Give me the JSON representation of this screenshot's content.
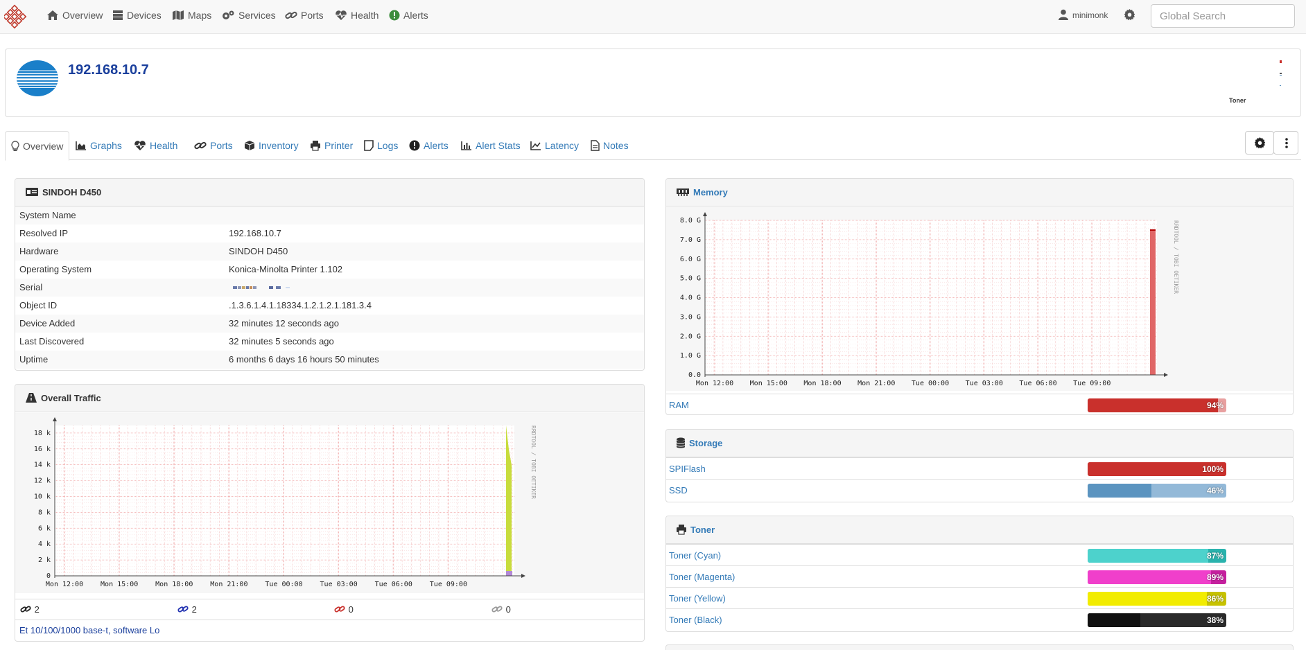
{
  "nav": {
    "items": [
      {
        "label": "Overview",
        "icon": "home-icon"
      },
      {
        "label": "Devices",
        "icon": "server-icon"
      },
      {
        "label": "Maps",
        "icon": "map-icon"
      },
      {
        "label": "Services",
        "icon": "cogs-icon"
      },
      {
        "label": "Ports",
        "icon": "link-icon"
      },
      {
        "label": "Health",
        "icon": "heartbeat-icon"
      },
      {
        "label": "Alerts",
        "icon": "alert-circle-icon"
      }
    ],
    "user": "minimonk",
    "search_placeholder": "Global Search"
  },
  "device": {
    "title": "192.168.10.7",
    "toner_mini_label": "Toner"
  },
  "tabs": [
    "Overview",
    "Graphs",
    "Health",
    "Ports",
    "Inventory",
    "Printer",
    "Logs",
    "Alerts",
    "Alert Stats",
    "Latency",
    "Notes"
  ],
  "overview_panel": {
    "title": "SINDOH D450",
    "rows": [
      {
        "key": "System Name",
        "value": ""
      },
      {
        "key": "Resolved IP",
        "value": "192.168.10.7"
      },
      {
        "key": "Hardware",
        "value": "SINDOH D450"
      },
      {
        "key": "Operating System",
        "value": "Konica-Minolta Printer 1.102"
      },
      {
        "key": "Serial",
        "value": ""
      },
      {
        "key": "Object ID",
        "value": ".1.3.6.1.4.1.18334.1.2.1.2.1.181.3.4"
      },
      {
        "key": "Device Added",
        "value": "32 minutes 12 seconds ago"
      },
      {
        "key": "Last Discovered",
        "value": "32 minutes 5 seconds ago"
      },
      {
        "key": "Uptime",
        "value": "6 months 6 days 16 hours 50 minutes"
      }
    ]
  },
  "traffic_panel": {
    "title": "Overall Traffic",
    "side_label": "RRDTOOL / TOBI OETIKER",
    "port_counts": [
      "2",
      "2",
      "0",
      "0"
    ],
    "port_desc": "Et 10/100/1000 base-t, software Lo"
  },
  "memory_panel": {
    "title": "Memory",
    "side_label": "RRDTOOL / TOBI OETIKER",
    "rows": [
      {
        "name": "RAM",
        "percent": 94,
        "label": "94%",
        "color": "#c9302c"
      }
    ]
  },
  "storage_panel": {
    "title": "Storage",
    "rows": [
      {
        "name": "SPIFlash",
        "percent": 100,
        "label": "100%",
        "color": "#c9302c"
      },
      {
        "name": "SSD",
        "percent": 46,
        "label": "46%",
        "color": "#5b94c0"
      }
    ]
  },
  "toner_panel": {
    "title": "Toner",
    "rows": [
      {
        "name": "Toner (Cyan)",
        "percent": 87,
        "label": "87%",
        "color": "#4dd2cc"
      },
      {
        "name": "Toner (Magenta)",
        "percent": 89,
        "label": "89%",
        "color": "#f03fcb"
      },
      {
        "name": "Toner (Yellow)",
        "percent": 86,
        "label": "86%",
        "color": "#f2ec00"
      },
      {
        "name": "Toner (Black)",
        "percent": 38,
        "label": "38%",
        "color": "#111111"
      }
    ]
  },
  "chart_data": [
    {
      "type": "area",
      "name": "overall-traffic",
      "x_ticks": [
        "Mon 12:00",
        "Mon 15:00",
        "Mon 18:00",
        "Mon 21:00",
        "Tue 00:00",
        "Tue 03:00",
        "Tue 06:00",
        "Tue 09:00"
      ],
      "y_ticks": [
        "0",
        "2 k",
        "4 k",
        "6 k",
        "8 k",
        "10 k",
        "12 k",
        "14 k",
        "16 k",
        "18 k"
      ],
      "ylim": [
        0,
        19000
      ],
      "series": [
        {
          "values_end": [
            19000,
            16000,
            14000
          ],
          "color": "#c8dc3c"
        }
      ]
    },
    {
      "type": "area",
      "name": "memory",
      "x_ticks": [
        "Mon 12:00",
        "Mon 15:00",
        "Mon 18:00",
        "Mon 21:00",
        "Tue 00:00",
        "Tue 03:00",
        "Tue 06:00",
        "Tue 09:00"
      ],
      "y_ticks": [
        "0.0",
        "1.0 G",
        "2.0 G",
        "3.0 G",
        "4.0 G",
        "5.0 G",
        "6.0 G",
        "7.0 G",
        "8.0 G"
      ],
      "ylim": [
        0,
        8
      ],
      "series": [
        {
          "values_end": [
            7.5
          ],
          "color": "#e06666"
        }
      ]
    }
  ]
}
